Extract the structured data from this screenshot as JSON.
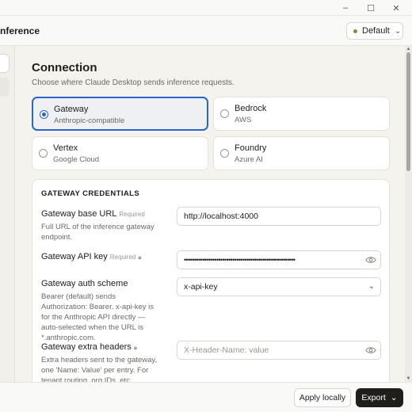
{
  "window": {
    "title": "nference",
    "minimize_glyph": "–",
    "maximize_glyph": "☐",
    "close_glyph": "✕"
  },
  "header": {
    "profile": {
      "label": "Default",
      "dot_color": "#6a9a3a",
      "chevron": "⌄"
    }
  },
  "connection": {
    "title": "Connection",
    "subtitle": "Choose where Claude Desktop sends inference requests.",
    "options": [
      {
        "label": "Gateway",
        "sub": "Anthropic-compatible",
        "selected": true
      },
      {
        "label": "Bedrock",
        "sub": "AWS",
        "selected": false
      },
      {
        "label": "Vertex",
        "sub": "Google Cloud",
        "selected": false
      },
      {
        "label": "Foundry",
        "sub": "Azure AI",
        "selected": false
      }
    ]
  },
  "credentials": {
    "title": "GATEWAY CREDENTIALS",
    "fields": [
      {
        "label": "Gateway base URL",
        "badge": "Required",
        "desc": "Full URL of the inference gateway endpoint.",
        "value": "http://localhost:4000"
      },
      {
        "label": "Gateway API key",
        "badge": "Required",
        "desc": "",
        "value": "•••••••••••••••••••••••••••••••••••••••••••••••••••••••"
      },
      {
        "label": "Gateway auth scheme",
        "badge": "",
        "desc": "Bearer (default) sends Authorization: Bearer. x-api-key is for the Anthropic API directly — auto-selected when the URL is *.anthropic.com.",
        "value": "x-api-key"
      },
      {
        "label": "Gateway extra headers",
        "badge": "",
        "desc": "Extra headers sent to the gateway, one 'Name: Value' per entry. For tenant routing, org IDs, etc.",
        "placeholder": "X-Header-Name: value"
      }
    ]
  },
  "footer": {
    "apply_label": "Apply locally",
    "export_label": "Export",
    "export_chevron": "⌄"
  }
}
